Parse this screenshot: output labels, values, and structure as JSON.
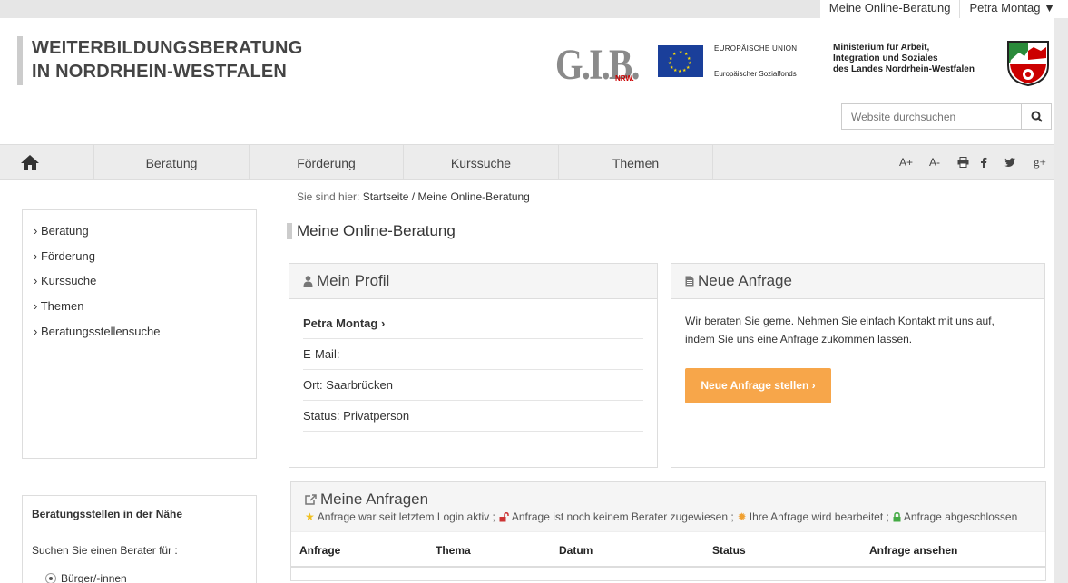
{
  "topbar": {
    "online_beratung": "Meine Online-Beratung",
    "user_menu": "Petra Montag ▼"
  },
  "brand": {
    "line1": "WEITERBILDUNGSBERATUNG",
    "line2": "IN NORDRHEIN-WESTFALEN"
  },
  "logos": {
    "gib": "G.I.B.",
    "gib_nrw": "NRW.",
    "eu_line1": "EUROPÄISCHE UNION",
    "eu_line2": "Europäischer Sozialfonds",
    "ministry_line1": "Ministerium für Arbeit,",
    "ministry_line2": "Integration und Soziales",
    "ministry_line3": "des Landes Nordrhein-Westfalen"
  },
  "search": {
    "placeholder": "Website durchsuchen"
  },
  "nav": {
    "items": [
      "Beratung",
      "Förderung",
      "Kurssuche",
      "Themen"
    ]
  },
  "tools": {
    "font_up": "A+",
    "font_down": "A-"
  },
  "breadcrumb": {
    "prefix": "Sie sind hier:",
    "home": "Startseite",
    "sep": " / ",
    "current": "Meine Online-Beratung"
  },
  "sidebar": {
    "items": [
      "Beratung",
      "Förderung",
      "Kurssuche",
      "Themen",
      "Beratungsstellensuche"
    ]
  },
  "nearby": {
    "title": "Beratungsstellen in der Nähe",
    "prompt": "Suchen Sie einen Berater für :",
    "option1": "Bürger/-innen"
  },
  "page_title": "Meine Online-Beratung",
  "profile": {
    "title": "Mein Profil",
    "name": "Petra Montag ›",
    "email": "E-Mail:",
    "ort": "Ort: Saarbrücken",
    "status": "Status: Privatperson"
  },
  "anfrage": {
    "title": "Neue Anfrage",
    "text1": "Wir beraten Sie gerne. Nehmen Sie einfach Kontakt mit uns auf,",
    "text2": "indem Sie uns eine Anfrage zukommen lassen.",
    "button": "Neue Anfrage stellen ›"
  },
  "anfragen": {
    "title": "Meine Anfragen",
    "legend": [
      "Anfrage war seit letztem Login aktiv ;",
      "Anfrage ist noch keinem Berater zugewiesen ;",
      "Ihre Anfrage wird bearbeitet ;",
      "Anfrage abgeschlossen"
    ],
    "columns": [
      "Anfrage",
      "Thema",
      "Datum",
      "Status",
      "Anfrage ansehen"
    ]
  }
}
